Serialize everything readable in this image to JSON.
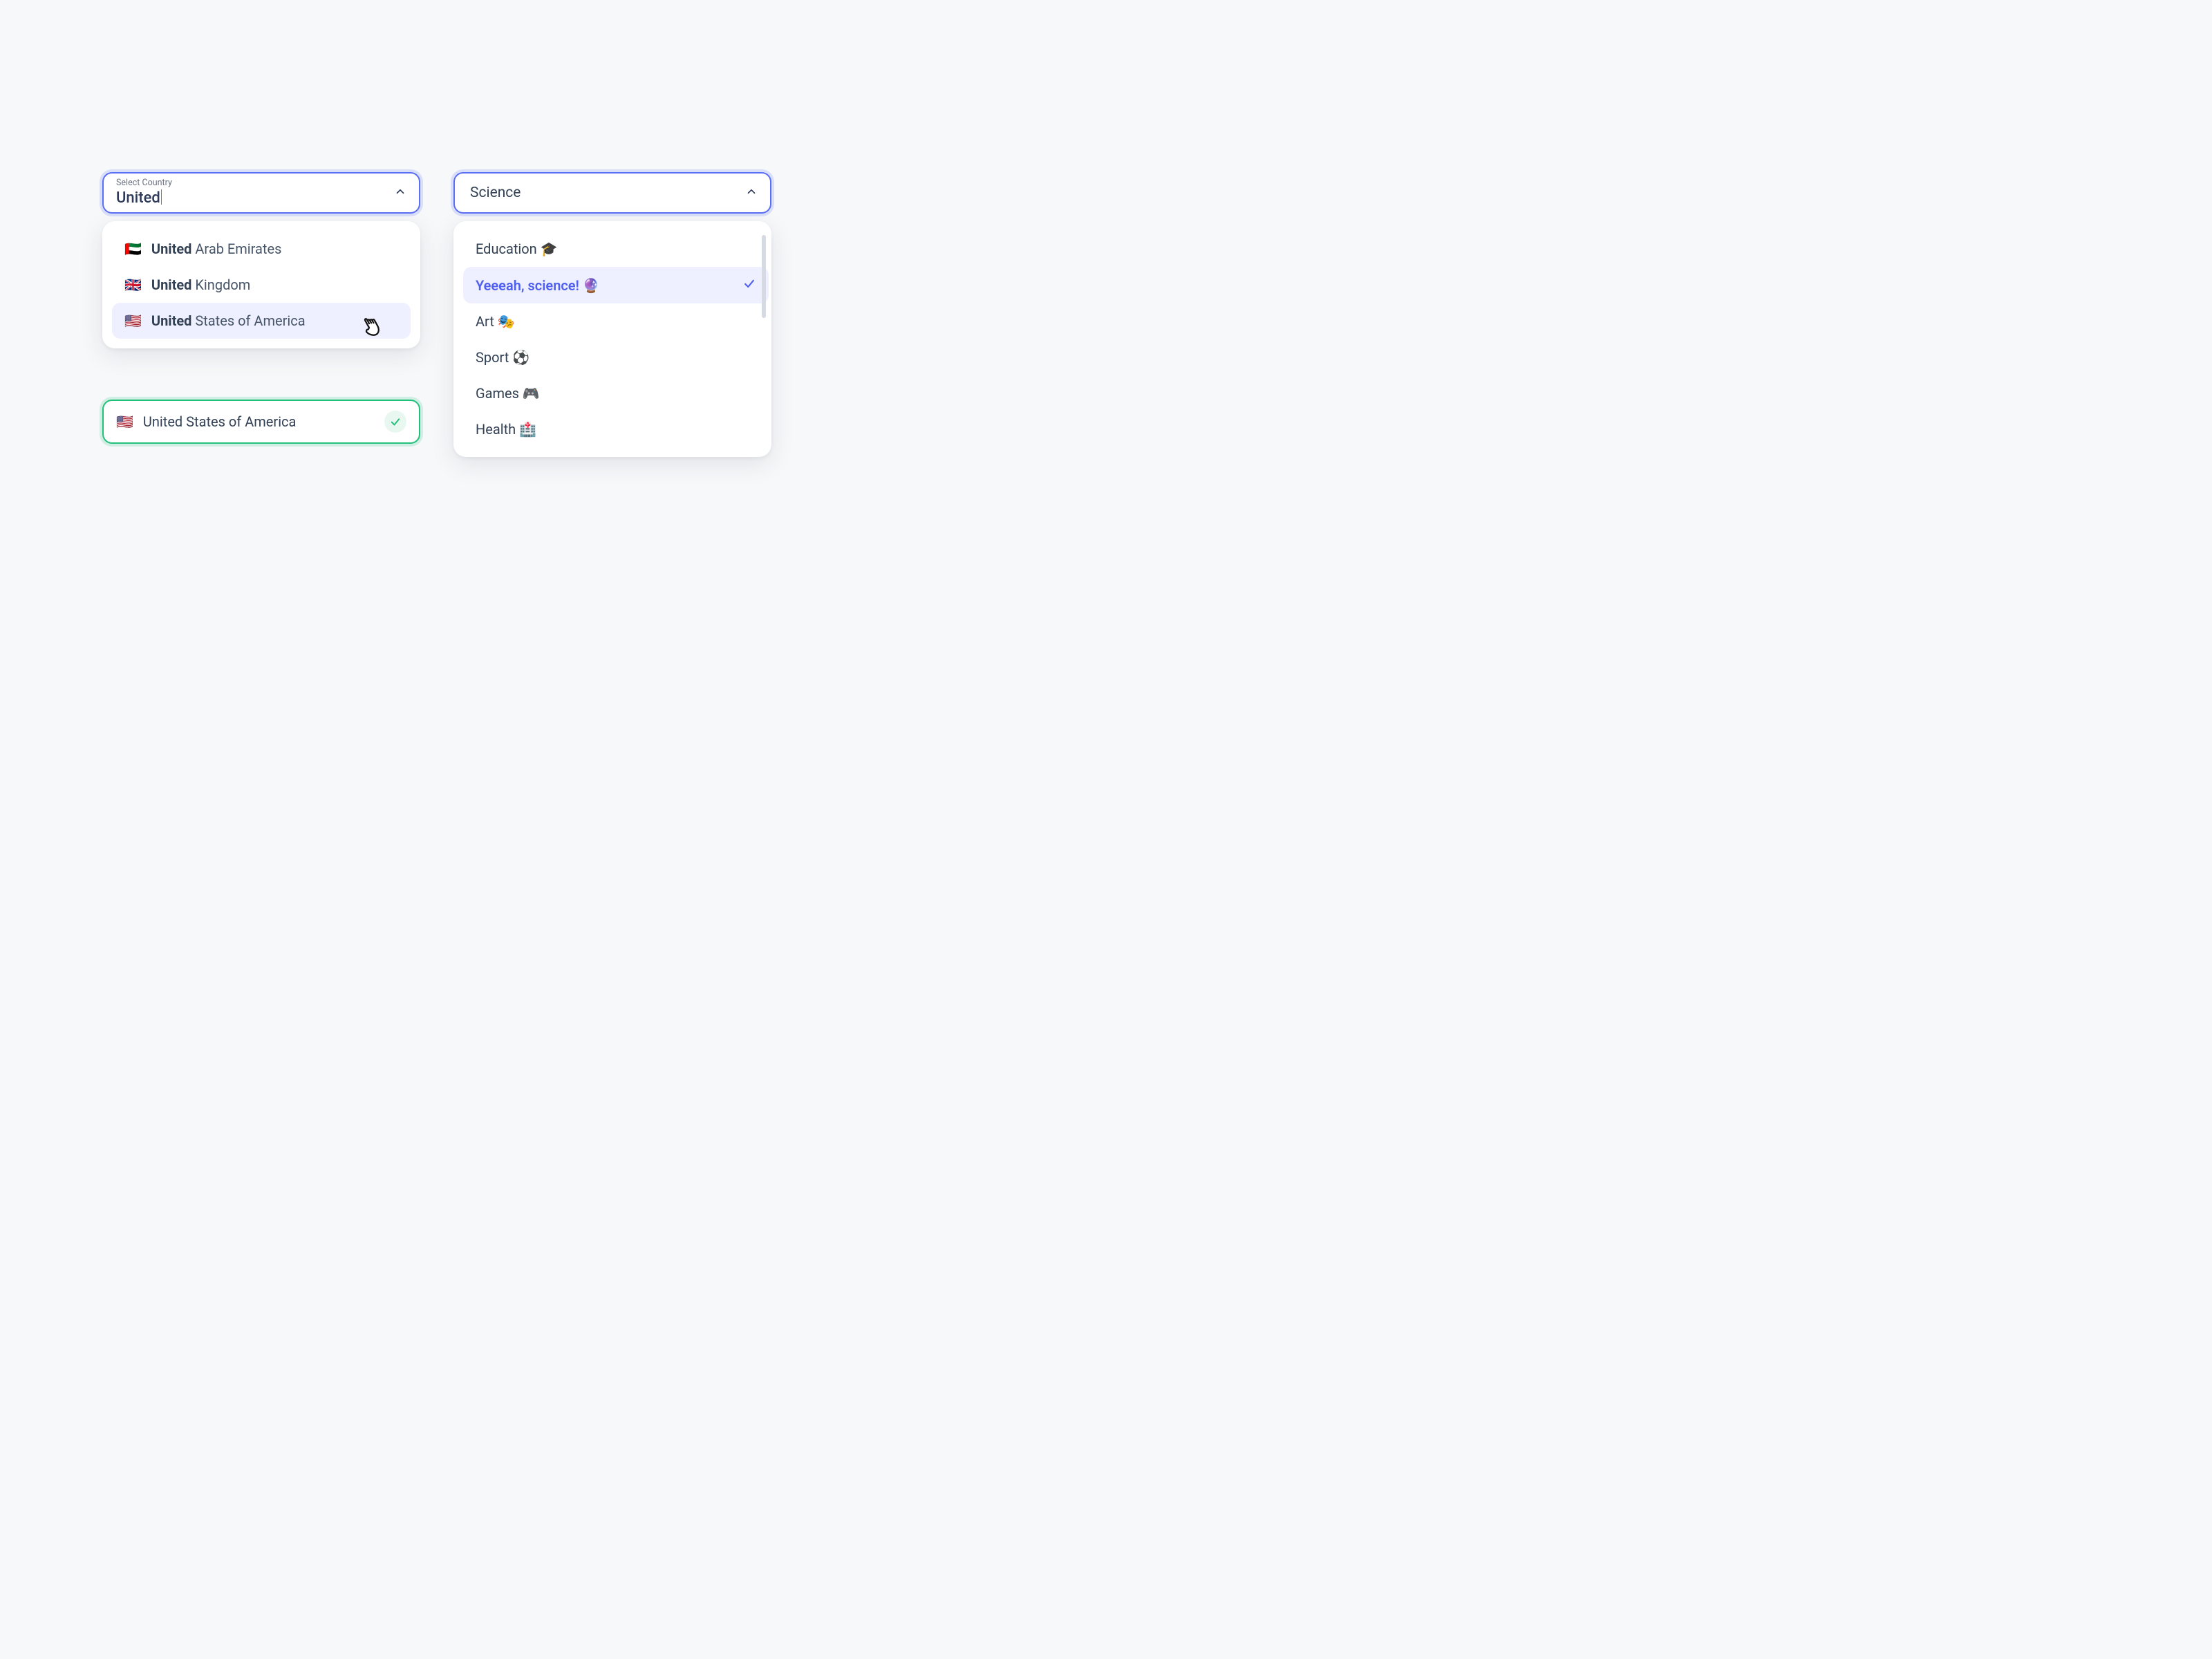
{
  "country_combo": {
    "label": "Select Country",
    "value": "United"
  },
  "country_options": [
    {
      "flag": "🇦🇪",
      "match": "United",
      "rest": " Arab Emirates"
    },
    {
      "flag": "🇬🇧",
      "match": "United",
      "rest": " Kingdom"
    },
    {
      "flag": "🇺🇸",
      "match": "United",
      "rest": " States of America"
    }
  ],
  "confirmed": {
    "flag": "🇺🇸",
    "text": "United States of America"
  },
  "category_combo": {
    "value": "Science"
  },
  "category_options": [
    {
      "text": "Education 🎓"
    },
    {
      "text": "Yeeeah, science! 🔮",
      "selected": true
    },
    {
      "text": "Art 🎭"
    },
    {
      "text": "Sport ⚽"
    },
    {
      "text": "Games 🎮"
    },
    {
      "text": "Health 🏥"
    }
  ]
}
